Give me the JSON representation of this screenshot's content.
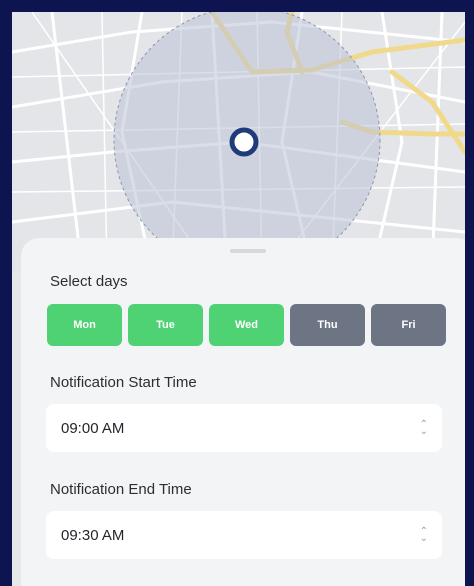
{
  "days_section": {
    "label": "Select days",
    "days": [
      {
        "label": "Mon",
        "selected": true
      },
      {
        "label": "Tue",
        "selected": true
      },
      {
        "label": "Wed",
        "selected": true
      },
      {
        "label": "Thu",
        "selected": false
      },
      {
        "label": "Fri",
        "selected": false
      }
    ]
  },
  "start_time": {
    "label": "Notification Start Time",
    "value": "09:00 AM"
  },
  "end_time": {
    "label": "Notification End Time",
    "value": "09:30 AM"
  },
  "colors": {
    "selected_day": "#4ed273",
    "unselected_day": "#6d7585",
    "frame_border": "#0d1450",
    "primary_button": "#2b67d8",
    "location_pin": "#1f3b7a"
  },
  "icons": {
    "location_pin": "location-pin-icon",
    "select_chevron": "chevron-up-down-icon"
  }
}
